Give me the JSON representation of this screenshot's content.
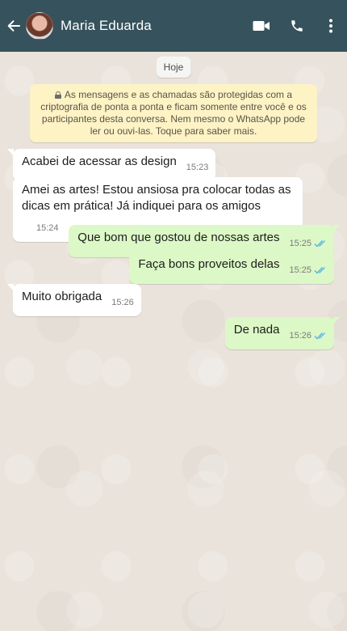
{
  "header": {
    "contact_name": "Maria Eduarda",
    "icons": [
      "back-arrow-icon",
      "video-call-icon",
      "phone-icon",
      "more-options-icon"
    ],
    "background": "#36525c"
  },
  "date_label": "Hoje",
  "encryption_notice": "As mensagens e as chamadas são protegidas com a criptografia de ponta a ponta e ficam somente entre você e os participantes desta conversa. Nem mesmo o WhatsApp pode ler ou ouvi-las. Toque para saber mais.",
  "messages": [
    {
      "direction": "in",
      "text": "Acabei de acessar as design",
      "time": "15:23"
    },
    {
      "direction": "in",
      "text": "Amei as artes! Estou ansiosa pra colocar todas as dicas em prática! Já indiquei para os amigos",
      "time": "15:24"
    },
    {
      "direction": "out",
      "text": "Que bom que gostou de nossas artes",
      "time": "15:25",
      "status": "read"
    },
    {
      "direction": "out",
      "text": "Faça bons proveitos delas",
      "time": "15:25",
      "status": "read"
    },
    {
      "direction": "in",
      "text": "Muito obrigada",
      "time": "15:26"
    },
    {
      "direction": "out",
      "text": "De nada",
      "time": "15:26",
      "status": "read"
    }
  ],
  "colors": {
    "incoming_bubble": "#ffffff",
    "outgoing_bubble": "#dcf8c6",
    "read_ticks": "#4fb6ec",
    "notice_background": "#fdf3c5"
  }
}
